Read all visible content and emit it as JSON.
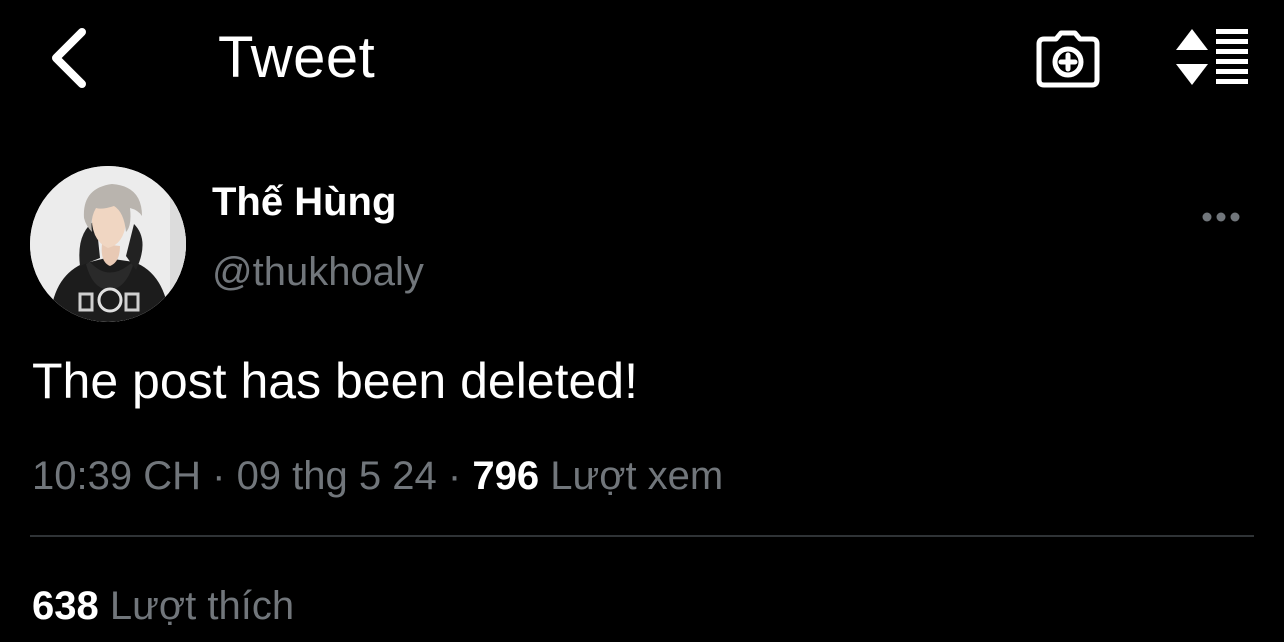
{
  "header": {
    "title": "Tweet",
    "back_icon": "chevron-left-icon",
    "camera_icon": "camera-add-icon",
    "sort_icon": "sort-list-icon"
  },
  "author": {
    "display_name": "Thế Hùng",
    "handle": "@thukhoaly",
    "avatar_icon": "profile-photo",
    "more_icon": "more-horizontal-icon"
  },
  "tweet": {
    "text": "The post has been deleted!",
    "time": "10:39 CH",
    "separator": "·",
    "date": "09 thg 5 24",
    "views_count": "796",
    "views_label": "Lượt xem"
  },
  "stats": {
    "likes_count": "638",
    "likes_label": "Lượt thích"
  },
  "colors": {
    "background": "#000000",
    "primary_text": "#ffffff",
    "secondary_text": "#71767b",
    "divider": "#2f3336"
  }
}
